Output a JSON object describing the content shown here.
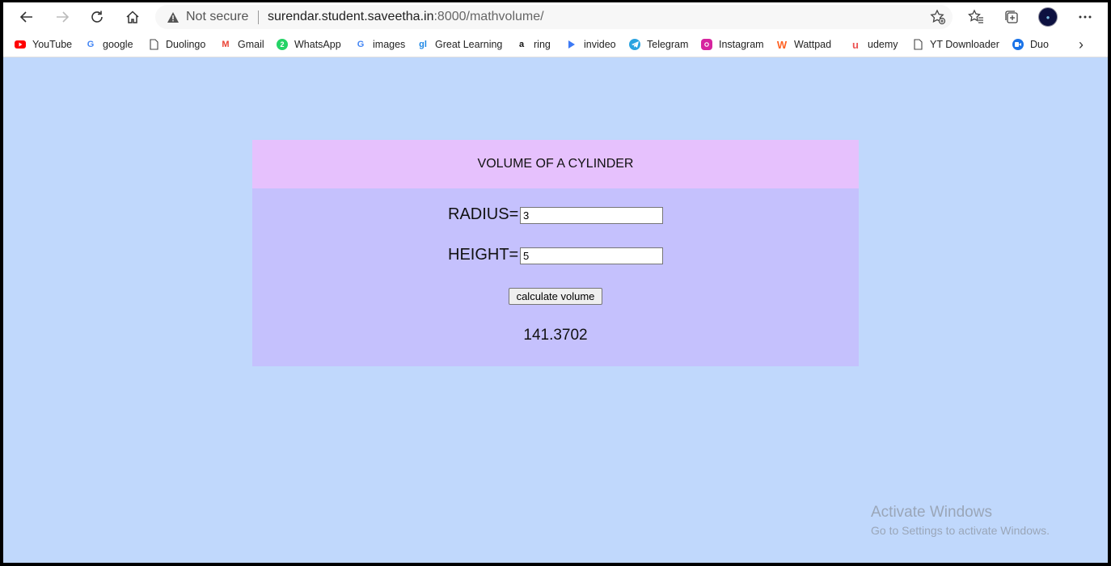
{
  "browser": {
    "security_label": "Not secure",
    "url_host": "surendar.student.saveetha.in",
    "url_rest": ":8000/mathvolume/",
    "icons": [
      "back-icon",
      "forward-icon",
      "reload-icon",
      "home-icon",
      "warning-icon",
      "add-favorite-icon",
      "favorites-icon",
      "collections-icon",
      "profile-avatar",
      "more-icon"
    ]
  },
  "bookmarks": [
    {
      "label": "YouTube",
      "icon": "youtube-icon",
      "color": "#ff0000"
    },
    {
      "label": "google",
      "icon": "google-icon",
      "color": "#4285f4"
    },
    {
      "label": "Duolingo",
      "icon": "page-icon",
      "color": "#555555"
    },
    {
      "label": "Gmail",
      "icon": "gmail-icon",
      "color": "#ea4335"
    },
    {
      "label": "WhatsApp",
      "icon": "whatsapp-icon",
      "color": "#25d366"
    },
    {
      "label": "images",
      "icon": "google-icon",
      "color": "#4285f4"
    },
    {
      "label": "Great Learning",
      "icon": "great-learning-icon",
      "color": "#1e88e5"
    },
    {
      "label": "ring",
      "icon": "amazon-icon",
      "color": "#ff9900"
    },
    {
      "label": "invideo",
      "icon": "invideo-icon",
      "color": "#3d7af5"
    },
    {
      "label": "Telegram",
      "icon": "telegram-icon",
      "color": "#2aa3e0"
    },
    {
      "label": "Instagram",
      "icon": "instagram-icon",
      "color": "#d6249f"
    },
    {
      "label": "Wattpad",
      "icon": "wattpad-icon",
      "color": "#ff6122"
    },
    {
      "label": "udemy",
      "icon": "udemy-icon",
      "color": "#ec5252"
    },
    {
      "label": "YT Downloader",
      "icon": "page-icon",
      "color": "#555555"
    },
    {
      "label": "Duo",
      "icon": "duo-icon",
      "color": "#1a73e8"
    }
  ],
  "form": {
    "title": "VOLUME OF A CYLINDER",
    "radius_label": "RADIUS=",
    "radius_value": "3",
    "height_label": "HEIGHT=",
    "height_value": "5",
    "button_label": "calculate volume",
    "result": "141.3702"
  },
  "watermark": {
    "title": "Activate Windows",
    "subtitle": "Go to Settings to activate Windows."
  },
  "colors": {
    "page_bg": "#c0d8fc",
    "header_bg": "#e6c1fd",
    "body_bg": "#c5c1fd"
  }
}
